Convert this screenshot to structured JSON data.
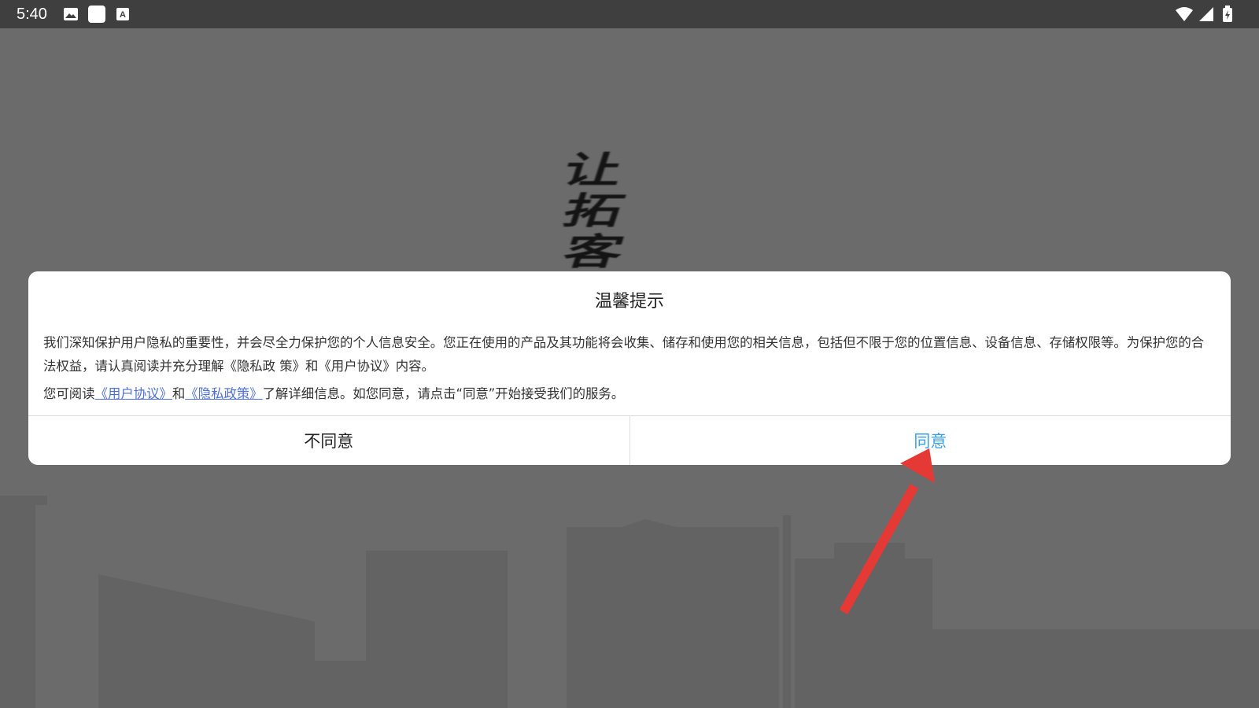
{
  "status_bar": {
    "time": "5:40",
    "left_icons": [
      "image-icon",
      "app-square-icon",
      "font-download-icon"
    ],
    "right_icons": [
      "wifi-icon",
      "cell-signal-icon",
      "battery-icon"
    ]
  },
  "splash": {
    "logo_chars": [
      "让",
      "拓",
      "客"
    ]
  },
  "dialog": {
    "title": "温馨提示",
    "paragraph1": "我们深知保护用户隐私的重要性，并会尽全力保护您的个人信息安全。您正在使用的产品及其功能将会收集、储存和使用您的相关信息，包括但不限于您的位置信息、设备信息、存储权限等。为保护您的合法权益，请认真阅读并充分理解《隐私政 策》和《用户协议》内容。",
    "paragraph2_prefix": "您可阅读",
    "user_agreement_link": "《用户协议》",
    "paragraph2_and": "和",
    "privacy_policy_link": "《隐私政策》",
    "paragraph2_suffix": "了解详细信息。如您同意，请点击“同意”开始接受我们的服务。",
    "disagree_label": "不同意",
    "agree_label": "同意"
  },
  "colors": {
    "overlay_background": "#6b6b6b",
    "status_bar": "#3f3f3f",
    "agree_button": "#3aa0e6",
    "link": "#4f6fd6",
    "annotation_arrow": "#e53935"
  }
}
